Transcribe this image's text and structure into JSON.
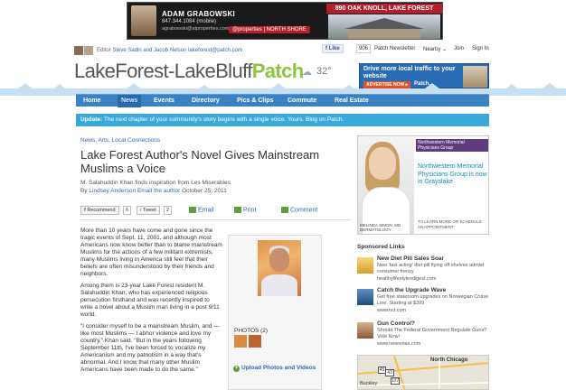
{
  "top_ad": {
    "agent_name": "ADAM GRABOWSKI",
    "phone": "847.344.1084 (mobile)",
    "email": "agrabowski@atproperties.com",
    "brand": "@properties | NORTH SHORE",
    "address": "890 OAK KNOLL, LAKE FOREST"
  },
  "editor_bar": {
    "label": "Editor",
    "editors": "Steve Sadin and Jacob Nelson",
    "email": "lakeforest@patch.com"
  },
  "header": {
    "like_label": "Like",
    "like_count": "906",
    "newsletter": "Patch Newsletter",
    "nearby": "Nearby ⌄",
    "join": "Join",
    "sign_in": "Sign In"
  },
  "logo": {
    "main": "LakeForest-LakeBluff",
    "patch": "Patch"
  },
  "weather": {
    "temp": "32°",
    "icon": "cloud-icon"
  },
  "small_ad": {
    "text": "Drive more local traffic to your website",
    "button": "ADVERTISE NOW ▸",
    "brand": "Patch."
  },
  "nav": {
    "items": [
      "Home",
      "News",
      "Events",
      "Directory",
      "Pics & Clips",
      "Commute",
      "Real Estate"
    ],
    "active": "News"
  },
  "update": {
    "label": "Update:",
    "text": "The next chapter of your community's story begins with a single voice. Yours. Blog on Patch."
  },
  "article": {
    "categories": "News, Arts, Local Connections",
    "headline": "Lake Forest Author's Novel Gives Mainstream Muslims a Voice",
    "subhead": "M. Salahuddin Khan finds inspiration from Les Miserables.",
    "byline_prefix": "By",
    "author": "Lindsey Anderson",
    "email_author": "Email the author",
    "date": "October 25, 2011",
    "share": {
      "recommend": "Recommend",
      "recommend_count": "6",
      "tweet": "Tweet",
      "tweet_count": "2",
      "email": "Email",
      "print": "Print",
      "comment": "Comment"
    },
    "paragraphs": [
      "More than 10 years have come and gone since the tragic events of Sept. 11, 2001, and although most Americans now know better than to blame mainstream Muslims for the actions of a few militant extremists, many Muslims living in America still feel that their beliefs are often misunderstood by their friends and neighbors.",
      "Among them is 23-year Lake Forest resident M. Salahuddin Khan, who has experienced religious persecution firsthand and was recently inspired to write a novel about a Muslim man living in a post 9/11 world.",
      "\"I consider myself to be a mainstream Muslim, and — like most Muslims — I abhor violence and love my country,\" Khan said. \"But in the years following September 11th, I've been forced to vocalize my Americanism and my patriotism in a way that's abnormal. And I know that many other Muslim Americans have been made to do the same.\""
    ],
    "photos_label": "PHOTOS (2)",
    "upload_label": "Upload Photos and Videos"
  },
  "right_ad": {
    "logo": "Northwestern Memorial Physicians Group",
    "text": "Northwestern Memorial Physicians Group is now in Grayslake",
    "doctor": "MELINDA SIMON, MD · DERMATOLOGY",
    "cta": "TO LEARN MORE OR SCHEDULE AN APPOINTMENT"
  },
  "sponsored": {
    "title": "Sponsored Links",
    "links": [
      {
        "title": "New Diet Pill Sales Soar",
        "desc": "New 'fast acting' diet pill flying off shelves admist consumer frenzy",
        "url": "healthylifestylesdigest.com"
      },
      {
        "title": "Catch the Upgrade Wave",
        "desc": "Get free stateroom upgrades on Norwegian Cruise Line. Starting at $399",
        "url": "www.ncl.com"
      },
      {
        "title": "Gun Control?",
        "desc": "Should The Federal Government Regulate Guns? Vote Now!",
        "url": "www.newsmax.com"
      }
    ]
  },
  "map": {
    "label": "North Chicago",
    "town": "Buckley",
    "badges": [
      "45",
      "137",
      "43"
    ]
  }
}
